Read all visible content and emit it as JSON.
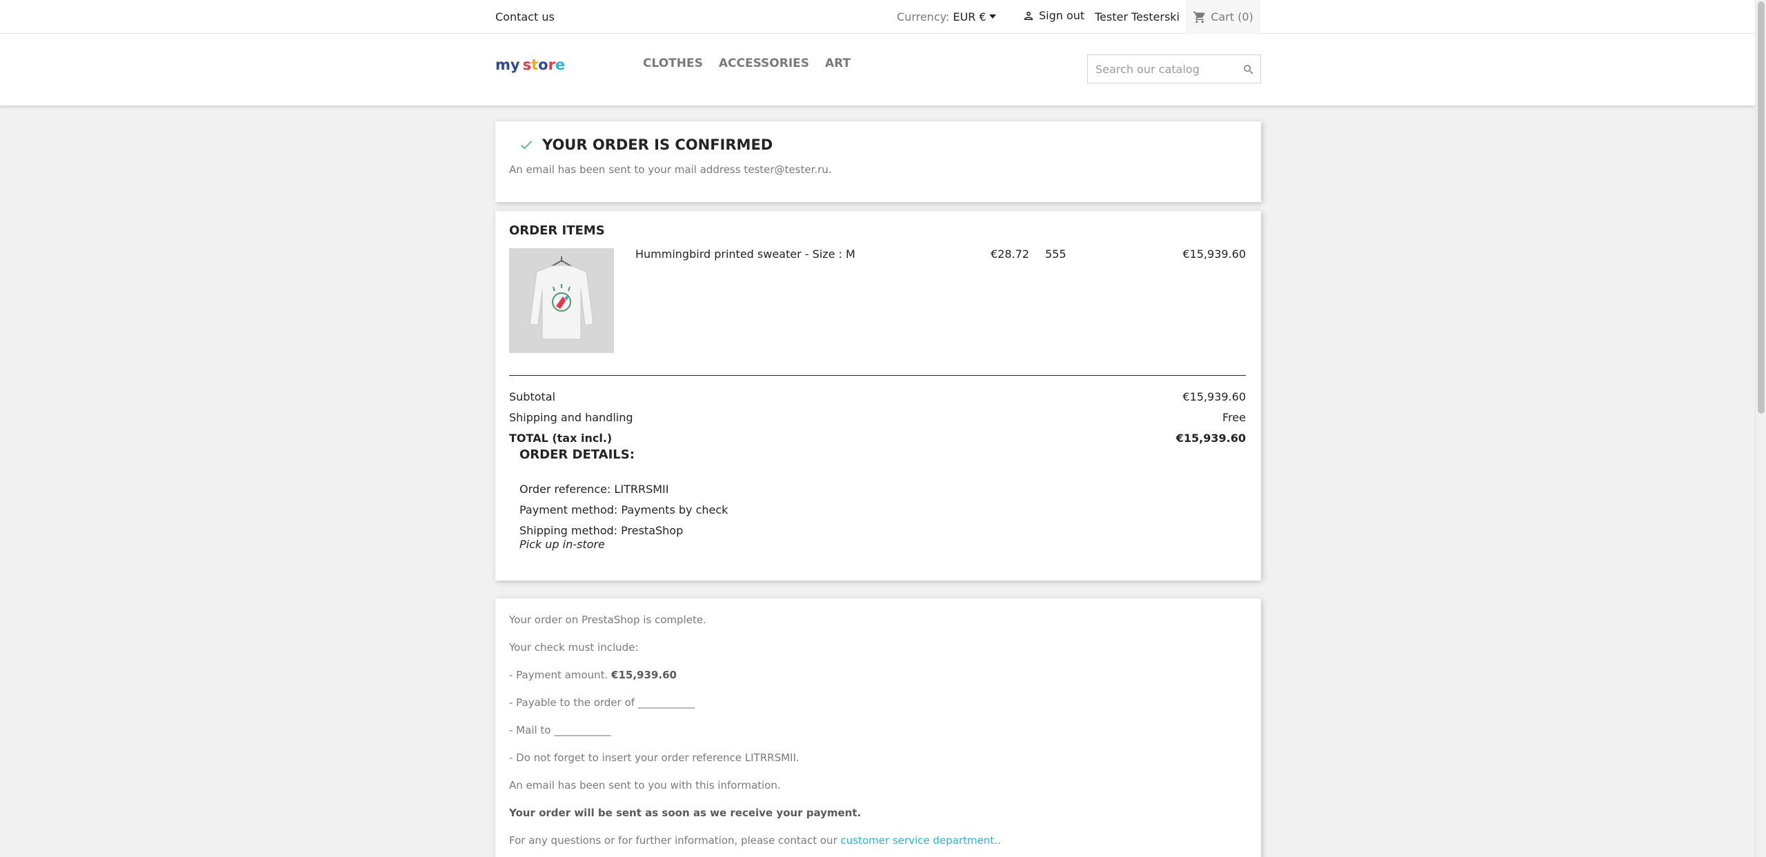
{
  "topbar": {
    "contact": "Contact us",
    "currency_label": "Currency:",
    "currency_value": "EUR €",
    "sign_out": "Sign out",
    "user_name": "Tester Testerski",
    "cart": "Cart (0)"
  },
  "header": {
    "logo_text": "my store",
    "menu": [
      "CLOTHES",
      "ACCESSORIES",
      "ART"
    ],
    "search_placeholder": "Search our catalog"
  },
  "confirmation": {
    "title": "YOUR ORDER IS CONFIRMED",
    "message": "An email has been sent to your mail address tester@tester.ru."
  },
  "order_items": {
    "title": "ORDER ITEMS",
    "items": [
      {
        "name": "Hummingbird printed sweater - Size : M",
        "unit_price": "€28.72",
        "quantity": "555",
        "total": "€15,939.60"
      }
    ],
    "subtotal_label": "Subtotal",
    "subtotal_value": "€15,939.60",
    "shipping_label": "Shipping and handling",
    "shipping_value": "Free",
    "total_label": "TOTAL (tax incl.)",
    "total_value": "€15,939.60"
  },
  "order_details": {
    "title": "ORDER DETAILS:",
    "reference": "Order reference: LITRRSMII",
    "payment": "Payment method: Payments by check",
    "shipping": "Shipping method: PrestaShop",
    "shipping_note": "Pick up in-store"
  },
  "payment_info": {
    "complete": "Your order on PrestaShop is complete.",
    "check_include": "Your check must include:",
    "amount_prefix": "- Payment amount.",
    "amount_value": "€15,939.60",
    "payable": "- Payable to the order of ___________",
    "mail_to": "- Mail to ___________",
    "reference_note": "- Do not forget to insert your order reference LITRRSMII.",
    "email_sent": "An email has been sent to you with this information.",
    "will_be_sent": "Your order will be sent as soon as we receive your payment.",
    "questions_prefix": "For any questions or for further information, please contact our",
    "service_link": "customer service department.",
    "questions_suffix": "."
  },
  "colors": {
    "accent": "#24b9d7",
    "success": "#4cbb6c",
    "background": "#f1f1f1"
  },
  "icons": [
    "user-icon",
    "cart-icon",
    "search-icon",
    "check-icon"
  ]
}
